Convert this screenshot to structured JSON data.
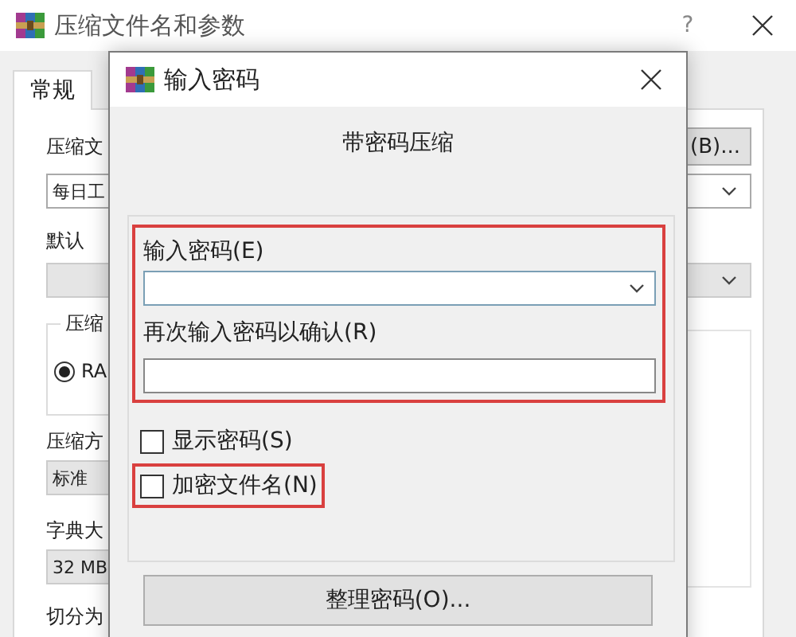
{
  "main_window": {
    "title": "压缩文件名和参数",
    "help": "?",
    "tabs": [
      {
        "label": "常规",
        "selected": true
      }
    ],
    "archive_name_label": "压缩文",
    "archive_name": "每日工",
    "browse_button": "(B)...",
    "profile_label": "默认",
    "format_group": "压缩",
    "format_options": [
      {
        "label": "RA",
        "selected": true
      }
    ],
    "method_label": "压缩方",
    "method": "标准",
    "dictionary_label": "字典大",
    "dictionary": "32 MB",
    "split_label": "切分为"
  },
  "password_dialog": {
    "title": "输入密码",
    "heading": "带密码压缩",
    "fields_highlighted": true,
    "password_label": "输入密码(E)",
    "confirm_label": "再次输入密码以确认(R)",
    "options": [
      {
        "label": "显示密码(S)",
        "checked": false,
        "highlighted": false
      },
      {
        "label": "加密文件名(N)",
        "checked": false,
        "highlighted": true
      }
    ],
    "organize_button": "整理密码(O)..."
  }
}
